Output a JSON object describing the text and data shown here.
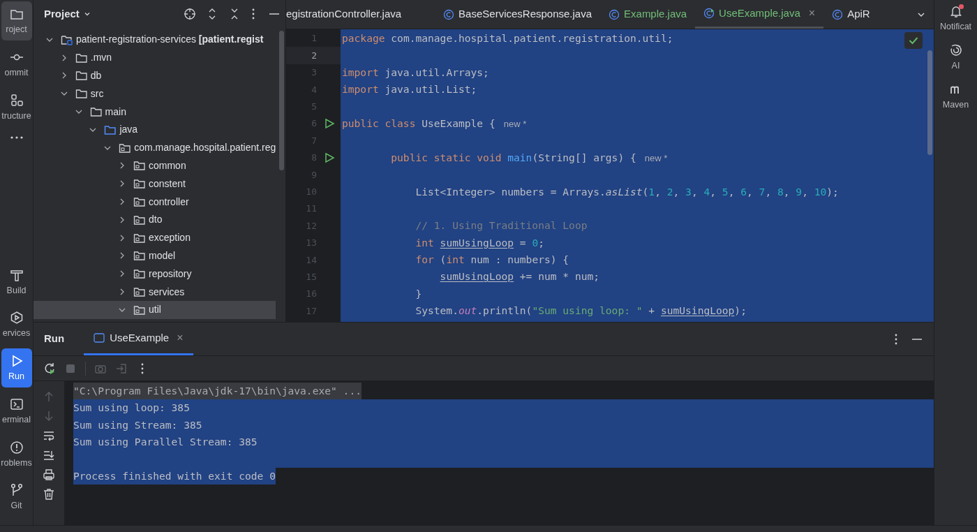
{
  "left_toolbar": {
    "top": [
      {
        "kind": "project",
        "label": "roject",
        "selected": true
      },
      {
        "kind": "commit",
        "label": "ommit",
        "selected": false
      },
      {
        "kind": "structure",
        "label": "tructure",
        "selected": false
      },
      {
        "kind": "more",
        "selected": false
      }
    ],
    "bottom": [
      {
        "kind": "build",
        "label": "Build",
        "selected": false
      },
      {
        "kind": "services",
        "label": "ervices",
        "selected": false
      },
      {
        "kind": "run",
        "label": "Run",
        "selected": true
      },
      {
        "kind": "terminal",
        "label": "erminal",
        "selected": false
      },
      {
        "kind": "problems",
        "label": "roblems",
        "selected": false
      },
      {
        "kind": "git",
        "label": "Git",
        "selected": false
      }
    ]
  },
  "project_panel": {
    "title": "Project",
    "tree": [
      {
        "kind": "module",
        "label": "patient-registration-services **[patient.regist**",
        "expanded": true,
        "selected": false,
        "children": [
          {
            "kind": "folder",
            "label": ".mvn",
            "expanded": false,
            "selected": false
          },
          {
            "kind": "folder",
            "label": "db",
            "expanded": false,
            "selected": false
          },
          {
            "kind": "folder",
            "label": "src",
            "expanded": true,
            "selected": false,
            "children": [
              {
                "kind": "folder",
                "label": "main",
                "expanded": true,
                "selected": false,
                "children": [
                  {
                    "kind": "source",
                    "label": "java",
                    "expanded": true,
                    "selected": false,
                    "children": [
                      {
                        "kind": "package",
                        "label": "com.manage.hospital.patient.reg",
                        "expanded": true,
                        "selected": false,
                        "children": [
                          {
                            "kind": "package",
                            "label": "common",
                            "expanded": false,
                            "selected": false
                          },
                          {
                            "kind": "package",
                            "label": "constent",
                            "expanded": false,
                            "selected": false
                          },
                          {
                            "kind": "package",
                            "label": "controller",
                            "expanded": false,
                            "selected": false
                          },
                          {
                            "kind": "package",
                            "label": "dto",
                            "expanded": false,
                            "selected": false
                          },
                          {
                            "kind": "package",
                            "label": "exception",
                            "expanded": false,
                            "selected": false
                          },
                          {
                            "kind": "package",
                            "label": "model",
                            "expanded": false,
                            "selected": false
                          },
                          {
                            "kind": "package",
                            "label": "repository",
                            "expanded": false,
                            "selected": false
                          },
                          {
                            "kind": "package",
                            "label": "services",
                            "expanded": false,
                            "selected": false
                          },
                          {
                            "kind": "package",
                            "label": "util",
                            "expanded": true,
                            "selected": true
                          }
                        ]
                      }
                    ]
                  }
                ]
              }
            ]
          }
        ]
      }
    ]
  },
  "editor_tabs": [
    {
      "label": "egistrationController.java",
      "selected": false,
      "added": false,
      "kind": "cut"
    },
    {
      "label": "BaseServicesResponse.java",
      "selected": false,
      "added": false,
      "kind": "class"
    },
    {
      "label": "Example.java",
      "selected": false,
      "added": true,
      "kind": "class"
    },
    {
      "label": "UseExample.java",
      "selected": true,
      "added": true,
      "kind": "runnable",
      "close": "×"
    },
    {
      "label": "ApiR",
      "selected": false,
      "added": false,
      "kind": "class"
    }
  ],
  "editor": {
    "selected": true,
    "lines": [
      {
        "number": "1",
        "current": false,
        "run_marker": false,
        "tokens": [
          {
            "kind": "kw",
            "text": "package"
          },
          {
            "kind": "plain",
            "text": " com.manage.hospital.patient.registration.util;"
          }
        ]
      },
      {
        "number": "2",
        "current": true,
        "run_marker": false
      },
      {
        "number": "3",
        "current": false,
        "run_marker": false,
        "tokens": [
          {
            "kind": "kw",
            "text": "import"
          },
          {
            "kind": "plain",
            "text": " java.util.Arrays;"
          }
        ]
      },
      {
        "number": "4",
        "current": false,
        "run_marker": false,
        "tokens": [
          {
            "kind": "kw",
            "text": "import"
          },
          {
            "kind": "plain",
            "text": " java.util.List;"
          }
        ]
      },
      {
        "number": "5",
        "current": false,
        "run_marker": false
      },
      {
        "number": "6",
        "current": false,
        "run_marker": true,
        "tokens": [
          {
            "kind": "kw",
            "text": "public class"
          },
          {
            "kind": "plain",
            "text": " UseExample {"
          },
          {
            "kind": "hint",
            "text": "new *"
          }
        ]
      },
      {
        "number": "7",
        "current": false,
        "run_marker": false
      },
      {
        "number": "8",
        "current": false,
        "run_marker": true,
        "tokens": [
          {
            "kind": "kw",
            "text": "        public static void "
          },
          {
            "kind": "fn",
            "text": "main"
          },
          {
            "kind": "plain",
            "text": "(String[] args) {"
          },
          {
            "kind": "hint",
            "text": "new *"
          }
        ]
      },
      {
        "number": "9",
        "current": false,
        "run_marker": false
      },
      {
        "number": "10",
        "current": false,
        "run_marker": false,
        "tokens": [
          {
            "kind": "plain",
            "text": "            List<Integer> numbers = Arrays."
          },
          {
            "kind": "italic",
            "text": "asList"
          },
          {
            "kind": "plain",
            "text": "("
          },
          {
            "kind": "num",
            "text": "1"
          },
          {
            "kind": "plain",
            "text": ", "
          },
          {
            "kind": "num",
            "text": "2"
          },
          {
            "kind": "plain",
            "text": ", "
          },
          {
            "kind": "num",
            "text": "3"
          },
          {
            "kind": "plain",
            "text": ", "
          },
          {
            "kind": "num",
            "text": "4"
          },
          {
            "kind": "plain",
            "text": ", "
          },
          {
            "kind": "num",
            "text": "5"
          },
          {
            "kind": "plain",
            "text": ", "
          },
          {
            "kind": "num",
            "text": "6"
          },
          {
            "kind": "plain",
            "text": ", "
          },
          {
            "kind": "num",
            "text": "7"
          },
          {
            "kind": "plain",
            "text": ", "
          },
          {
            "kind": "num",
            "text": "8"
          },
          {
            "kind": "plain",
            "text": ", "
          },
          {
            "kind": "num",
            "text": "9"
          },
          {
            "kind": "plain",
            "text": ", "
          },
          {
            "kind": "num",
            "text": "10"
          },
          {
            "kind": "plain",
            "text": ");"
          }
        ]
      },
      {
        "number": "11",
        "current": false,
        "run_marker": false
      },
      {
        "number": "12",
        "current": false,
        "run_marker": false,
        "tokens": [
          {
            "kind": "comment",
            "text": "            // 1. Using Traditional Loop"
          }
        ]
      },
      {
        "number": "13",
        "current": false,
        "run_marker": false,
        "tokens": [
          {
            "kind": "kw",
            "text": "            int "
          },
          {
            "kind": "var",
            "text": "sumUsingLoop"
          },
          {
            "kind": "plain",
            "text": " = "
          },
          {
            "kind": "num",
            "text": "0"
          },
          {
            "kind": "plain",
            "text": ";"
          }
        ]
      },
      {
        "number": "14",
        "current": false,
        "run_marker": false,
        "tokens": [
          {
            "kind": "kw",
            "text": "            for"
          },
          {
            "kind": "plain",
            "text": " ("
          },
          {
            "kind": "kw",
            "text": "int"
          },
          {
            "kind": "plain",
            "text": " num : numbers) {"
          }
        ]
      },
      {
        "number": "15",
        "current": false,
        "run_marker": false,
        "tokens": [
          {
            "kind": "var",
            "text": "                sumUsingLoop"
          },
          {
            "kind": "plain",
            "text": " += num * num;"
          }
        ]
      },
      {
        "number": "16",
        "current": false,
        "run_marker": false,
        "tokens": [
          {
            "kind": "plain",
            "text": "            }"
          }
        ]
      },
      {
        "number": "17",
        "current": false,
        "run_marker": false,
        "tokens": [
          {
            "kind": "plain",
            "text": "            System."
          },
          {
            "kind": "static",
            "text": "out"
          },
          {
            "kind": "plain",
            "text": ".println("
          },
          {
            "kind": "string",
            "text": "\"Sum using loop: \""
          },
          {
            "kind": "plain",
            "text": " + "
          },
          {
            "kind": "var",
            "text": "sumUsingLoop"
          },
          {
            "kind": "plain",
            "text": ");"
          }
        ]
      }
    ]
  },
  "right_toolbar": [
    {
      "kind": "notifications",
      "label": "Notificat",
      "unread": true
    },
    {
      "kind": "ai",
      "label": "AI"
    },
    {
      "kind": "maven",
      "label": "Maven"
    }
  ],
  "run_panel": {
    "title": "Run",
    "tabs": [
      {
        "label": "UseExample",
        "selected": true,
        "close": "×"
      }
    ],
    "toolbar": [
      {
        "kind": "rerun",
        "disabled": false
      },
      {
        "kind": "stop",
        "disabled": true
      },
      {
        "kind": "camera",
        "disabled": true
      },
      {
        "kind": "exit",
        "disabled": true
      },
      {
        "kind": "more",
        "disabled": false
      }
    ],
    "side_tools": [
      {
        "kind": "up",
        "disabled": true
      },
      {
        "kind": "down",
        "disabled": true
      },
      {
        "kind": "wrap",
        "disabled": false
      },
      {
        "kind": "scroll-end",
        "disabled": false
      },
      {
        "kind": "print",
        "disabled": false
      },
      {
        "kind": "trash",
        "disabled": false
      }
    ],
    "console": [
      {
        "kind": "command",
        "text": "\"C:\\Program Files\\Java\\jdk-17\\bin\\java.exe\" ...",
        "selected": false
      },
      {
        "kind": "output",
        "text": "Sum using loop: 385",
        "selected": true
      },
      {
        "kind": "output",
        "text": "Sum using Stream: 385",
        "selected": true
      },
      {
        "kind": "output",
        "text": "Sum using Parallel Stream: 385",
        "selected": true
      },
      {
        "kind": "blank",
        "selected": true
      },
      {
        "kind": "exit",
        "text": "Process finished with exit code 0",
        "selected": true
      }
    ]
  }
}
